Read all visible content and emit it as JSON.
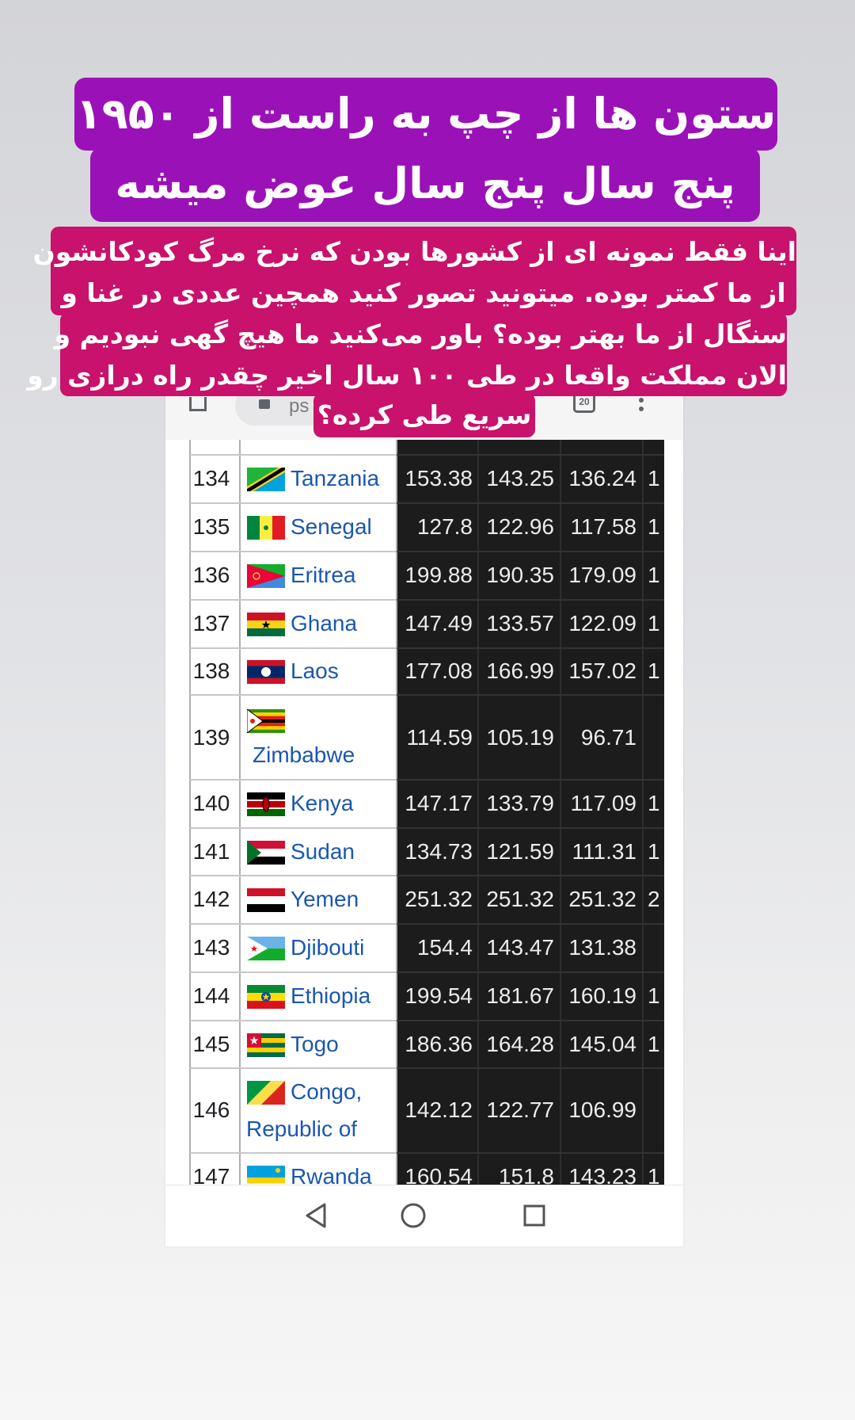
{
  "overlay": {
    "title_line1": "ستون ها از چپ به راست از ۱۹۵۰",
    "title_line2": "پنج سال پنج سال عوض میشه",
    "body_line1": "اینا فقط نمونه ای از کشورها بودن که نرخ مرگ کودکانشون",
    "body_line2": "از ما کمتر بوده. میتونید تصور کنید همچین عددی در غنا و",
    "body_line3": "سنگال از ما بهتر بوده؟ باور می‌کنید ما هیچ گهی نبودیم و",
    "body_line4": "الان مملکت واقعا در طی ۱۰۰ سال اخیر چقدر راه درازی رو",
    "body_line5": "سریع طی کرده؟"
  },
  "browser": {
    "url_fragment": "ps",
    "tab_count": "20"
  },
  "table": {
    "rows": [
      {
        "rank": "134",
        "country": "Tanzania",
        "v1": "153.38",
        "v2": "143.25",
        "v3": "136.24",
        "v4": "1"
      },
      {
        "rank": "135",
        "country": "Senegal",
        "v1": "127.8",
        "v2": "122.96",
        "v3": "117.58",
        "v4": "1"
      },
      {
        "rank": "136",
        "country": "Eritrea",
        "v1": "199.88",
        "v2": "190.35",
        "v3": "179.09",
        "v4": "1"
      },
      {
        "rank": "137",
        "country": "Ghana",
        "v1": "147.49",
        "v2": "133.57",
        "v3": "122.09",
        "v4": "1"
      },
      {
        "rank": "138",
        "country": "Laos",
        "v1": "177.08",
        "v2": "166.99",
        "v3": "157.02",
        "v4": "1"
      },
      {
        "rank": "139",
        "country": "Zimbabwe",
        "v1": "114.59",
        "v2": "105.19",
        "v3": "96.71",
        "v4": ""
      },
      {
        "rank": "140",
        "country": "Kenya",
        "v1": "147.17",
        "v2": "133.79",
        "v3": "117.09",
        "v4": "1"
      },
      {
        "rank": "141",
        "country": "Sudan",
        "v1": "134.73",
        "v2": "121.59",
        "v3": "111.31",
        "v4": "1"
      },
      {
        "rank": "142",
        "country": "Yemen",
        "v1": "251.32",
        "v2": "251.32",
        "v3": "251.32",
        "v4": "2"
      },
      {
        "rank": "143",
        "country": "Djibouti",
        "v1": "154.4",
        "v2": "143.47",
        "v3": "131.38",
        "v4": ""
      },
      {
        "rank": "144",
        "country": "Ethiopia",
        "v1": "199.54",
        "v2": "181.67",
        "v3": "160.19",
        "v4": "1"
      },
      {
        "rank": "145",
        "country": "Togo",
        "v1": "186.36",
        "v2": "164.28",
        "v3": "145.04",
        "v4": "1"
      },
      {
        "rank": "146",
        "country_line1": "Congo,",
        "country_line2": "Republic of",
        "v1": "142.12",
        "v2": "122.77",
        "v3": "106.99",
        "v4": ""
      },
      {
        "rank": "147",
        "country": "Rwanda",
        "v1": "160.54",
        "v2": "151.8",
        "v3": "143.23",
        "v4": "1"
      }
    ]
  },
  "colors": {
    "title_bg": "#9b11b8",
    "body_bg": "#c8126b",
    "link": "#1a57b0",
    "data_bg": "#1c1c1c"
  }
}
